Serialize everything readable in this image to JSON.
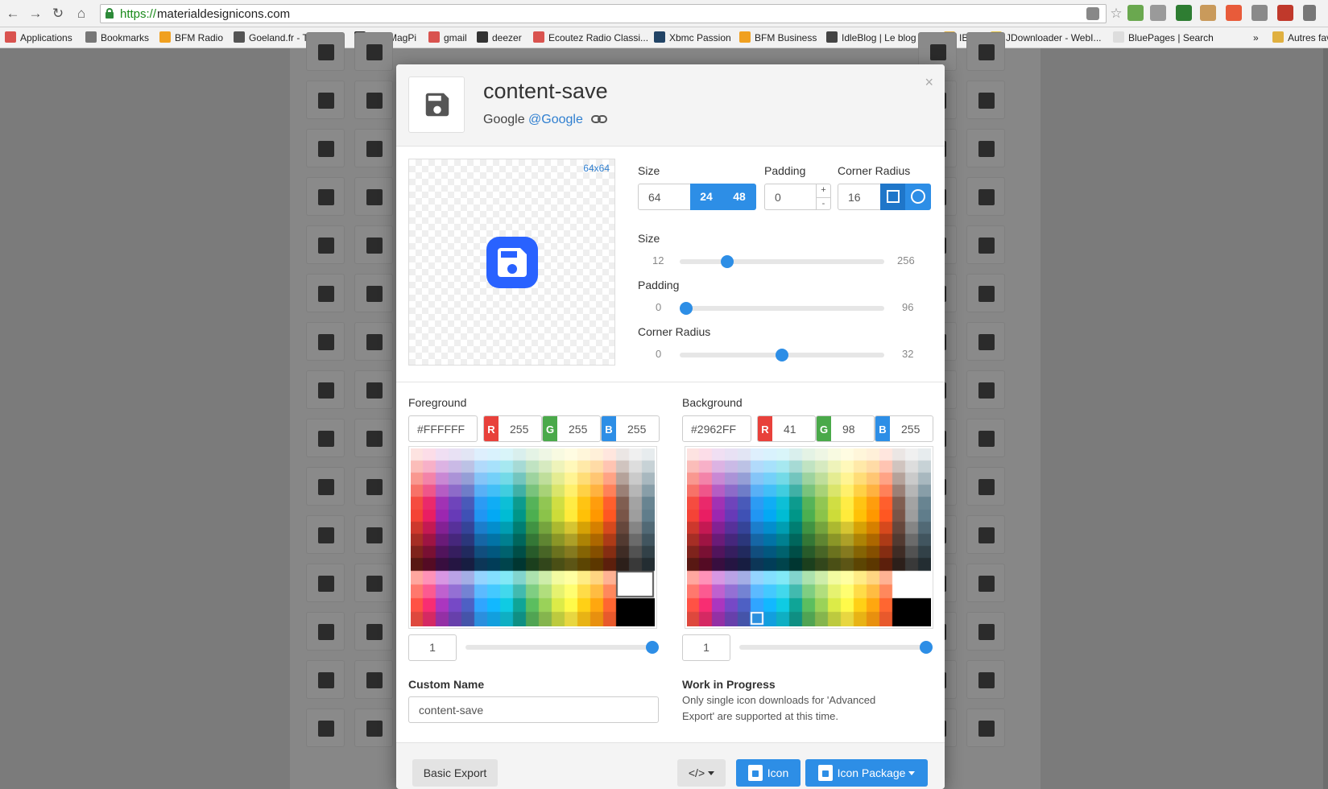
{
  "browser": {
    "url_scheme": "https://",
    "url_host": "materialdesignicons.com",
    "bookmarks": [
      {
        "label": "Applications",
        "color": "#d9534f"
      },
      {
        "label": "Bookmarks",
        "color": "#777777"
      },
      {
        "label": "BFM Radio",
        "color": "#f0a020"
      },
      {
        "label": "Goeland.fr - T-shirts...",
        "color": "#555555"
      },
      {
        "label": "The MagPi",
        "color": "#222222"
      },
      {
        "label": "gmail",
        "color": "#d9534f"
      },
      {
        "label": "deezer",
        "color": "#333333"
      },
      {
        "label": "Ecoutez Radio Classi...",
        "color": "#d9534f"
      },
      {
        "label": "Xbmc Passion",
        "color": "#224466"
      },
      {
        "label": "BFM Business",
        "color": "#f0a020"
      },
      {
        "label": "IdleBlog | Le blog d'i...",
        "color": "#444444"
      },
      {
        "label": "IBM",
        "color": "#e0b040"
      },
      {
        "label": "JDownloader - WebI...",
        "color": "#e0c040"
      },
      {
        "label": "BluePages | Search",
        "color": "#dddddd"
      },
      {
        "label": "»",
        "color": ""
      },
      {
        "label": "Autres favoris",
        "color": "#e0b040"
      }
    ]
  },
  "modal": {
    "title": "content-save",
    "author_prefix": "Google",
    "author_handle": "@Google",
    "close_label": "×",
    "preview_size_label": "64x64",
    "icon_color": "#2962FF",
    "size_label": "Size",
    "size_value": "64",
    "size_presets": [
      "24",
      "48"
    ],
    "padding_label": "Padding",
    "padding_value": "0",
    "spin_up": "+",
    "spin_down": "-",
    "radius_label": "Corner Radius",
    "radius_value": "16",
    "sliders": [
      {
        "label": "Size",
        "min": "12",
        "max": "256",
        "value": 64,
        "lo": 12,
        "hi": 256
      },
      {
        "label": "Padding",
        "min": "0",
        "max": "96",
        "value": 0,
        "lo": 0,
        "hi": 96
      },
      {
        "label": "Corner Radius",
        "min": "0",
        "max": "32",
        "value": 16,
        "lo": 0,
        "hi": 32
      }
    ],
    "foreground": {
      "label": "Foreground",
      "hex": "#FFFFFF",
      "r": "255",
      "g": "255",
      "b": "255",
      "alpha": "1",
      "alpha_value": 1
    },
    "background": {
      "label": "Background",
      "hex": "#2962FF",
      "r": "41",
      "g": "98",
      "b": "255",
      "alpha": "1",
      "alpha_value": 1
    },
    "channel_labels": {
      "r": "R",
      "g": "G",
      "b": "B"
    },
    "channel_colors": {
      "r": "#e8413b",
      "g": "#4aa94a",
      "b": "#2d8ee6"
    },
    "custom_name_label": "Custom Name",
    "custom_name_value": "content-save",
    "wip_title": "Work in Progress",
    "wip_line1": "Only single icon downloads for 'Advanced",
    "wip_line2": "Export' are supported at this time.",
    "footer": {
      "basic_export": "Basic Export",
      "embed_label": "</>",
      "icon_label": "Icon",
      "package_label": "Icon Package"
    }
  }
}
